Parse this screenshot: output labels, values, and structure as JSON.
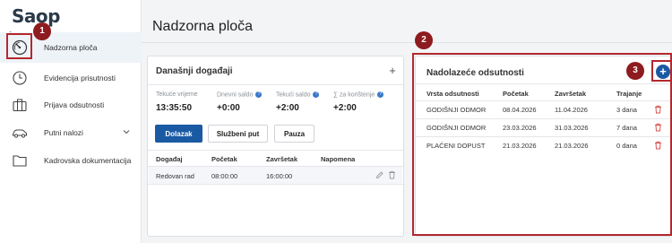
{
  "app": {
    "logo": "Saop"
  },
  "sidebar": {
    "items": [
      {
        "label": "Nadzorna ploča",
        "icon": "gauge-icon",
        "active": true
      },
      {
        "label": "Evidencija prisutnosti",
        "icon": "clock-icon"
      },
      {
        "label": "Prijava odsutnosti",
        "icon": "suitcase-icon"
      },
      {
        "label": "Putni nalozi",
        "icon": "car-icon",
        "expandable": true
      },
      {
        "label": "Kadrovska dokumentacija",
        "icon": "folder-icon"
      }
    ]
  },
  "page": {
    "title": "Nadzorna ploča"
  },
  "annotations": {
    "b1": "1",
    "b2": "2",
    "b3": "3"
  },
  "today": {
    "title": "Današnji događaji",
    "add": "+",
    "stats": [
      {
        "label": "Tekuće vrijeme",
        "value": "13:35:50",
        "help": false
      },
      {
        "label": "Dnevni saldo",
        "value": "+0:00",
        "help": true
      },
      {
        "label": "Tekući saldo",
        "value": "+2:00",
        "help": true
      },
      {
        "label": "∑ za korištenje",
        "value": "+2:00",
        "help": true
      }
    ],
    "buttons": {
      "arrival": "Dolazak",
      "business_trip": "Službeni put",
      "break": "Pauza"
    },
    "table": {
      "headers": [
        "Događaj",
        "Početak",
        "Završetak",
        "Napomena"
      ],
      "rows": [
        {
          "event": "Redovan rad",
          "start": "08:00:00",
          "end": "16:00:00",
          "note": ""
        }
      ]
    }
  },
  "absences": {
    "title": "Nadolazeće odsutnosti",
    "add": "+",
    "table": {
      "headers": [
        "Vrsta odsutnosti",
        "Početak",
        "Završetak",
        "Trajanje"
      ],
      "rows": [
        {
          "type": "GODIŠNJI ODMOR",
          "start": "08.04.2026",
          "end": "11.04.2026",
          "duration": "3 dana"
        },
        {
          "type": "GODIŠNJI ODMOR",
          "start": "23.03.2026",
          "end": "31.03.2026",
          "duration": "7 dana"
        },
        {
          "type": "PLAĆENI DOPUST",
          "start": "21.03.2026",
          "end": "21.03.2026",
          "duration": "0 dana"
        }
      ]
    }
  },
  "colors": {
    "primary": "#1a5aa3",
    "highlight": "#b3282e",
    "badge": "#8e1b1f",
    "delete": "#d9534f"
  }
}
